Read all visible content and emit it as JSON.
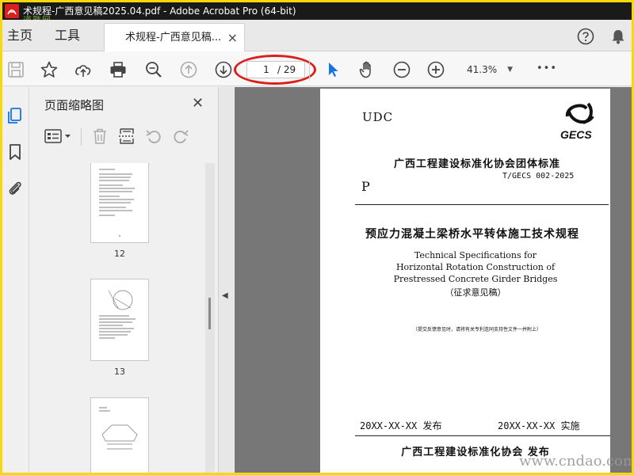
{
  "window": {
    "title": "术规程-广西意见稿2025.04.pdf - Adobe Acrobat Pro (64-bit)",
    "watermark_top": "道熟网",
    "watermark_bottom": "www.cndao.com"
  },
  "tabbar": {
    "home": "主页",
    "tools": "工具",
    "doc_tab": "术规程-广西意见稿...",
    "close": "×"
  },
  "toolbar": {
    "current_page": "1",
    "total_pages": "/ 29",
    "zoom": "41.3%",
    "more": "•••",
    "annotation_color": "#d9201c"
  },
  "thumbnails": {
    "title": "页面缩略图",
    "close": "✕",
    "items": [
      {
        "label": "12"
      },
      {
        "label": "13"
      },
      {
        "label": ""
      }
    ]
  },
  "page": {
    "udc": "UDC",
    "logo_text": "GECS",
    "org": "广西工程建设标准化协会团体标准",
    "code": "T/GECS 002-2025",
    "p": "P",
    "title_cn": "预应力混凝土梁桥水平转体施工技术规程",
    "title_en_1": "Technical Specifications for",
    "title_en_2": "Horizontal Rotation Construction of",
    "title_en_3": "Prestressed Concrete Girder Bridges",
    "draft": "（征求意见稿）",
    "note": "（提交反馈意见时，请将有关专利连同支持性文件一并附上）",
    "issue_date": "20XX-XX-XX 发布",
    "impl_date": "20XX-XX-XX 实施",
    "publisher": "广西工程建设标准化协会  发布"
  },
  "colors": {
    "accent_blue": "#1473e6",
    "border_yellow": "#f5d90a",
    "doc_background": "#777777"
  }
}
